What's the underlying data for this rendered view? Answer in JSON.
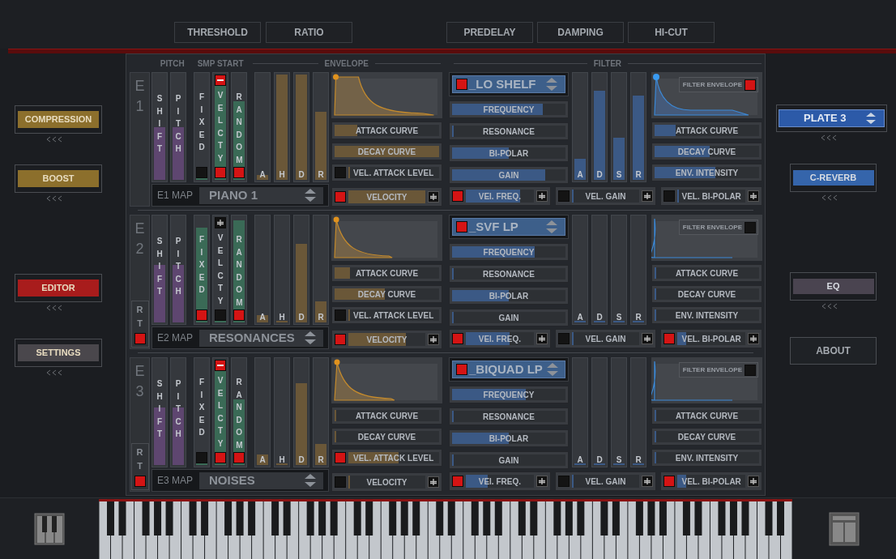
{
  "top_buttons_left": [
    "THRESHOLD",
    "RATIO"
  ],
  "top_buttons_right": [
    "PREDELAY",
    "DAMPING",
    "HI-CUT"
  ],
  "left_sidebar": [
    {
      "label": "COMPRESSION",
      "color": "#8c6f2c"
    },
    {
      "label": "BOOST",
      "color": "#8c6f2c"
    },
    {
      "label": "EDITOR",
      "color": "#a81c1c"
    },
    {
      "label": "SETTINGS",
      "color": "#4a474c"
    }
  ],
  "right_sidebar": [
    {
      "kind": "dropdown",
      "label": "PLATE 3",
      "color": "#2c5aa8"
    },
    {
      "kind": "button",
      "label": "C-REVERB",
      "color": "#3565ab"
    },
    {
      "kind": "button",
      "label": "EQ",
      "color": "#4a4450"
    },
    {
      "kind": "plain",
      "label": "ABOUT"
    }
  ],
  "headers": {
    "pitch": "PITCH",
    "smp_start": "SMP START",
    "envelope": "ENVELOPE",
    "filter": "FILTER"
  },
  "engines": [
    {
      "label": "E1",
      "pitch": [
        {
          "label": "SHIFT",
          "level": 0.5
        },
        {
          "label": "PITCH",
          "level": 0.5
        }
      ],
      "smp_start": [
        {
          "kind": "toggle",
          "label": "FIXED",
          "level": 0,
          "on": false
        },
        {
          "kind": "signed",
          "label": "VELCTY",
          "negative": true,
          "level": 1,
          "on": true
        },
        {
          "kind": "toggle",
          "label": "RANDOM",
          "level": 0.75,
          "on": true
        }
      ],
      "amp_env": [
        {
          "label": "A",
          "level": 0.05
        },
        {
          "label": "H",
          "level": 1
        },
        {
          "label": "D",
          "level": 1
        },
        {
          "label": "R",
          "level": 0.65
        }
      ],
      "env_controls": [
        {
          "kind": "slider",
          "label": "ATTACK CURVE",
          "level": 0.22
        },
        {
          "kind": "slider",
          "label": "DECAY CURVE",
          "level": 1
        },
        {
          "kind": "toggle_slider",
          "label": "VEL. ATTACK LEVEL",
          "on": false,
          "level": 0
        }
      ],
      "velocity": {
        "label": "VELOCITY",
        "on": true,
        "level": 1
      },
      "map": {
        "label": "E1 MAP",
        "value": "PIANO 1"
      },
      "filter_type": {
        "on": true,
        "value": "_LO SHELF"
      },
      "filter_controls": [
        {
          "label": "FREQUENCY",
          "level": 0.8
        },
        {
          "label": "RESONANCE",
          "level": 0
        },
        {
          "label": "BI-POLAR",
          "level": 0.5
        },
        {
          "label": "GAIN",
          "level": 0.82
        }
      ],
      "filter_adsr": [
        {
          "label": "A",
          "level": 0.2
        },
        {
          "label": "D",
          "level": 0.85
        },
        {
          "label": "S",
          "level": 0.4
        },
        {
          "label": "R",
          "level": 0.8
        }
      ],
      "filter_env": {
        "label": "FILTER ENVELOPE",
        "on": true
      },
      "filter_env_controls": [
        {
          "label": "ATTACK CURVE",
          "level": 0.2
        },
        {
          "label": "DECAY CURVE",
          "level": 0.53
        },
        {
          "label": "ENV. INTENSITY",
          "level": 0.58
        }
      ],
      "vel_mods": [
        {
          "label": "VEl. FREQ.",
          "on": true,
          "level": 0.8
        },
        {
          "label": "VEL. GAIN",
          "on": false,
          "level": 0
        },
        {
          "label": "VEL. BI-POLAR",
          "on": false,
          "level": 0
        }
      ]
    },
    {
      "label": "E2",
      "rt": {
        "label": "RT",
        "on": true
      },
      "pitch": [
        {
          "label": "SHIFT",
          "level": 0.55
        },
        {
          "label": "PITCH",
          "level": 0.55
        }
      ],
      "smp_start": [
        {
          "kind": "toggle",
          "label": "FIXED",
          "level": 0.9,
          "on": true
        },
        {
          "kind": "signed",
          "label": "VELCTY",
          "negative": false,
          "level": 0,
          "on": false
        },
        {
          "kind": "toggle",
          "label": "RANDOM",
          "level": 0.97,
          "on": true
        }
      ],
      "amp_env": [
        {
          "label": "A",
          "level": 0.07
        },
        {
          "label": "H",
          "level": 0
        },
        {
          "label": "D",
          "level": 0.75
        },
        {
          "label": "R",
          "level": 0.2
        }
      ],
      "env_controls": [
        {
          "kind": "slider",
          "label": "ATTACK CURVE",
          "level": 0.15
        },
        {
          "kind": "slider",
          "label": "DECAY CURVE",
          "level": 0.48
        },
        {
          "kind": "toggle_slider",
          "label": "VEL. ATTACK LEVEL",
          "on": false,
          "level": 0
        }
      ],
      "velocity": {
        "label": "VELOCITY",
        "on": true,
        "level": 0.75
      },
      "map": {
        "label": "E2 MAP",
        "value": "RESONANCES"
      },
      "filter_type": {
        "on": true,
        "value": "_SVF LP"
      },
      "filter_controls": [
        {
          "label": "FREQUENCY",
          "level": 0.73
        },
        {
          "label": "RESONANCE",
          "level": 0
        },
        {
          "label": "BI-POLAR",
          "level": 0.5
        },
        {
          "label": "GAIN",
          "level": 0
        }
      ],
      "filter_adsr": [
        {
          "label": "A",
          "level": 0
        },
        {
          "label": "D",
          "level": 0
        },
        {
          "label": "S",
          "level": 0
        },
        {
          "label": "R",
          "level": 0
        }
      ],
      "filter_env": {
        "label": "FILTER ENVELOPE",
        "on": false
      },
      "filter_env_controls": [
        {
          "label": "ATTACK CURVE",
          "level": 0
        },
        {
          "label": "DECAY CURVE",
          "level": 0
        },
        {
          "label": "ENV. INTENSITY",
          "level": 0
        }
      ],
      "vel_mods": [
        {
          "label": "VEl. FREQ.",
          "on": true,
          "level": 0.65
        },
        {
          "label": "VEL. GAIN",
          "on": false,
          "level": 0
        },
        {
          "label": "VEL. BI-POLAR",
          "on": true,
          "level": 0.13
        }
      ]
    },
    {
      "label": "E3",
      "rt": {
        "label": "RT",
        "on": true
      },
      "pitch": [
        {
          "label": "SHIFT",
          "level": 0.55
        },
        {
          "label": "PITCH",
          "level": 0.55
        }
      ],
      "smp_start": [
        {
          "kind": "toggle",
          "label": "FIXED",
          "level": 0,
          "on": false
        },
        {
          "kind": "signed",
          "label": "VELCTY",
          "negative": true,
          "level": 1,
          "on": true
        },
        {
          "kind": "toggle",
          "label": "RANDOM",
          "level": 0.62,
          "on": true
        }
      ],
      "amp_env": [
        {
          "label": "A",
          "level": 0.1
        },
        {
          "label": "H",
          "level": 0
        },
        {
          "label": "D",
          "level": 0.78
        },
        {
          "label": "R",
          "level": 0.2
        }
      ],
      "env_controls": [
        {
          "kind": "slider",
          "label": "ATTACK CURVE",
          "level": 0
        },
        {
          "kind": "slider",
          "label": "DECAY CURVE",
          "level": 0
        },
        {
          "kind": "toggle_slider",
          "label": "VEL. ATTACK LEVEL",
          "on": true,
          "level": 0.55
        }
      ],
      "velocity": {
        "label": "VELOCITY",
        "on": false,
        "level": 0
      },
      "map": {
        "label": "E3 MAP",
        "value": "NOISES"
      },
      "filter_type": {
        "on": true,
        "value": "_BIQUAD LP"
      },
      "filter_controls": [
        {
          "label": "FREQUENCY",
          "level": 0.65
        },
        {
          "label": "RESONANCE",
          "level": 0
        },
        {
          "label": "BI-POLAR",
          "level": 0.5
        },
        {
          "label": "GAIN",
          "level": 0
        }
      ],
      "filter_adsr": [
        {
          "label": "A",
          "level": 0
        },
        {
          "label": "D",
          "level": 0
        },
        {
          "label": "S",
          "level": 0
        },
        {
          "label": "R",
          "level": 0
        }
      ],
      "filter_env": {
        "label": "FILTER ENVELOPE",
        "on": false
      },
      "filter_env_controls": [
        {
          "label": "ATTACK CURVE",
          "level": 0
        },
        {
          "label": "DECAY CURVE",
          "level": 0
        },
        {
          "label": "ENV. INTENSITY",
          "level": 0
        }
      ],
      "vel_mods": [
        {
          "label": "VEl. FREQ.",
          "on": true,
          "level": 0.32
        },
        {
          "label": "VEL. GAIN",
          "on": false,
          "level": 0
        },
        {
          "label": "VEL. BI-POLAR",
          "on": true,
          "level": 0.13
        }
      ]
    }
  ]
}
